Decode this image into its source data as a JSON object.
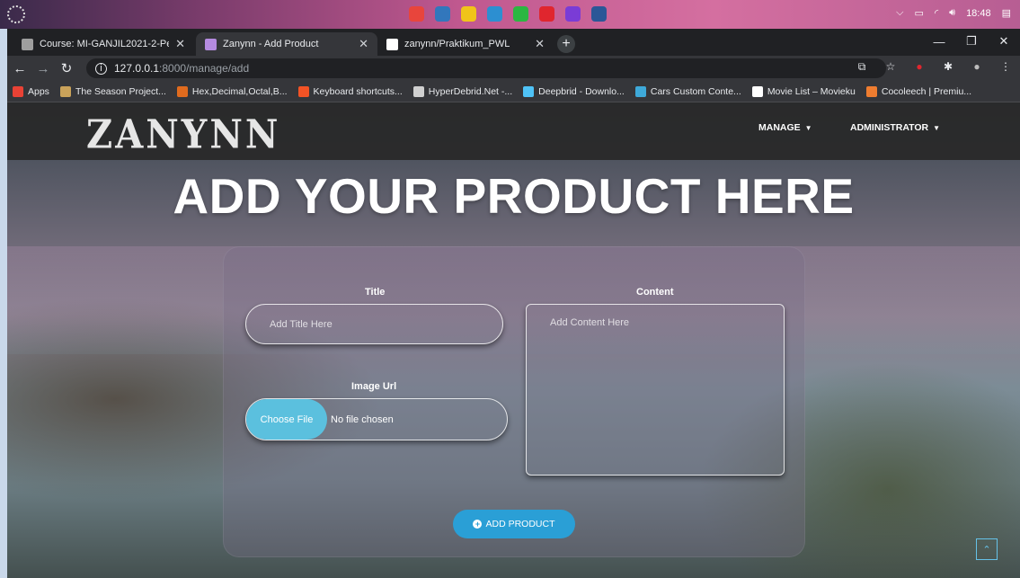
{
  "os": {
    "tray_time": "18:48",
    "taskbar_icons": [
      {
        "icon": "chrome-icon",
        "color": "#e8453c"
      },
      {
        "icon": "edge-icon",
        "color": "#3277bc"
      },
      {
        "icon": "files-icon",
        "color": "#f0c419"
      },
      {
        "icon": "vscode-icon",
        "color": "#2c8fd1"
      },
      {
        "icon": "whatsapp-icon",
        "color": "#2bb741"
      },
      {
        "icon": "opera-icon",
        "color": "#e0262e"
      },
      {
        "icon": "app-icon",
        "color": "#7a3cd6"
      },
      {
        "icon": "word-icon",
        "color": "#2b5797"
      }
    ]
  },
  "browser": {
    "tabs": [
      {
        "title": "Course: MI-GANJIL2021-2-Pemo",
        "favicon_color": "#9e9e9e",
        "active": false
      },
      {
        "title": "Zanynn - Add Product",
        "favicon_color": "#b58be0",
        "active": true
      },
      {
        "title": "zanynn/Praktikum_PWL",
        "favicon_color": "#ffffff",
        "active": false
      }
    ],
    "url_host": "127.0.0.1",
    "url_path": ":8000/manage/add",
    "bookmarks": [
      {
        "label": "Apps",
        "color": "#e94235"
      },
      {
        "label": "The Season Project...",
        "color": "#c9a25a"
      },
      {
        "label": "Hex,Decimal,Octal,B...",
        "color": "#e06b1e"
      },
      {
        "label": "Keyboard shortcuts...",
        "color": "#f35325"
      },
      {
        "label": "HyperDebrid.Net -...",
        "color": "#d0d0d0"
      },
      {
        "label": "Deepbrid - Downlo...",
        "color": "#4fc3f7"
      },
      {
        "label": "Cars Custom Conte...",
        "color": "#3ea9d9"
      },
      {
        "label": "Movie List – Movieku",
        "color": "#ffffff"
      },
      {
        "label": "Cocoleech | Premiu...",
        "color": "#ef7d30"
      }
    ]
  },
  "site": {
    "brand": "ZANYNN",
    "nav": [
      {
        "label": "MANAGE"
      },
      {
        "label": "ADMINISTRATOR"
      }
    ],
    "hero": "ADD YOUR PRODUCT HERE"
  },
  "form": {
    "title_label": "Title",
    "title_placeholder": "Add Title Here",
    "content_label": "Content",
    "content_placeholder": "Add Content Here",
    "image_label": "Image Url",
    "file_button": "Choose File",
    "file_status": "No file chosen",
    "submit_label": "ADD PRODUCT"
  }
}
